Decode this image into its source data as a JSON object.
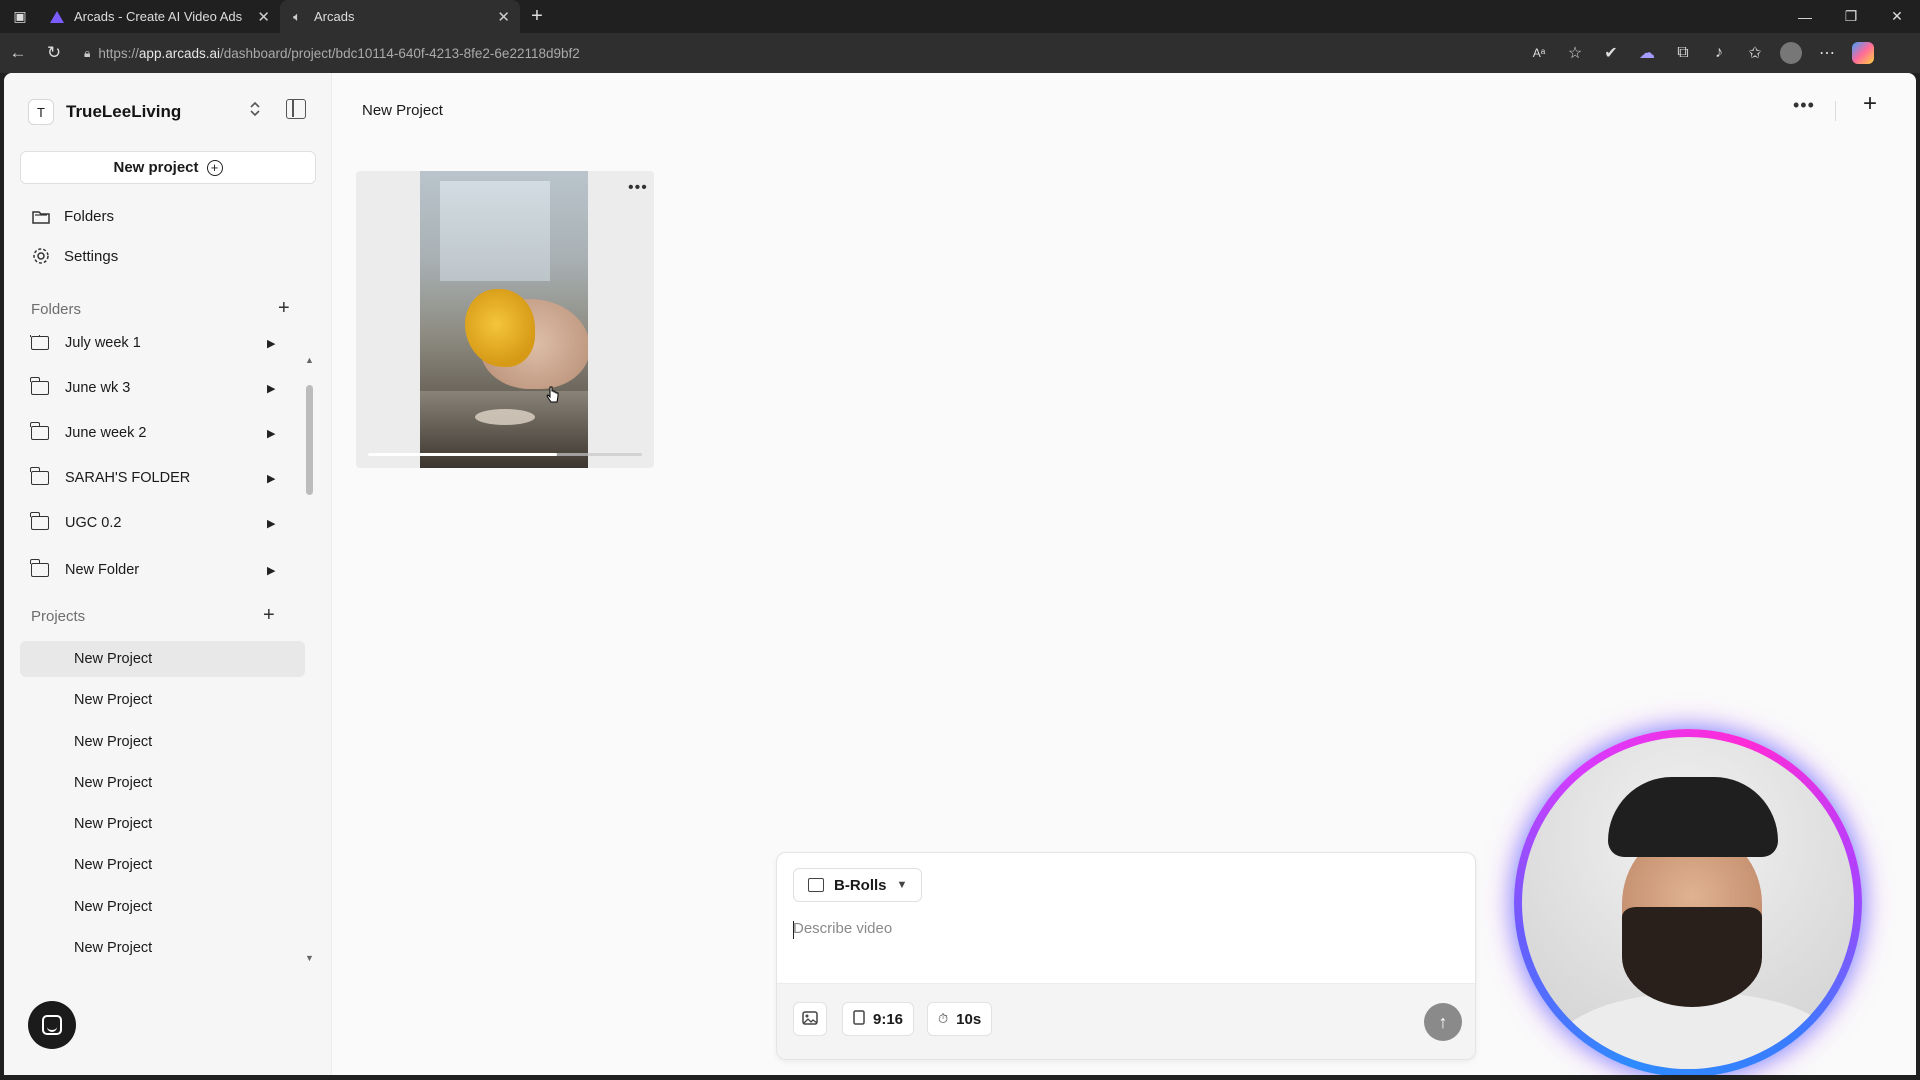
{
  "browser": {
    "tabs": [
      {
        "label": "Arcads - Create AI Video Ads",
        "icon": "arcads-logo-icon"
      },
      {
        "label": "Arcads",
        "icon": "speaker-icon"
      }
    ],
    "url_prefix": "https://",
    "url_domain": "app.arcads.ai",
    "url_path": "/dashboard/project/bdc10114-640f-4213-8fe2-6e22118d9bf2"
  },
  "sidebar": {
    "workspace_initial": "T",
    "workspace_name": "TrueLeeLiving",
    "new_project_label": "New project",
    "nav": [
      {
        "label": "Folders",
        "icon": "folder-icon"
      },
      {
        "label": "Settings",
        "icon": "gear-icon"
      }
    ],
    "folders_heading": "Folders",
    "folders": [
      {
        "name": "July week 1"
      },
      {
        "name": "June wk 3"
      },
      {
        "name": "June week 2"
      },
      {
        "name": "SARAH'S FOLDER"
      },
      {
        "name": "UGC 0.2"
      },
      {
        "name": "New Folder"
      }
    ],
    "projects_heading": "Projects",
    "projects": [
      {
        "name": "New Project",
        "active": true
      },
      {
        "name": "New Project"
      },
      {
        "name": "New Project"
      },
      {
        "name": "New Project"
      },
      {
        "name": "New Project"
      },
      {
        "name": "New Project"
      },
      {
        "name": "New Project"
      },
      {
        "name": "New Project"
      }
    ]
  },
  "main": {
    "title": "New Project",
    "video": {
      "progress": 0.69
    }
  },
  "prompt": {
    "mode_label": "B-Rolls",
    "placeholder": "Describe video",
    "aspect_ratio": "9:16",
    "duration": "10s"
  },
  "colors": {
    "browser_dark": "#202020",
    "app_bg": "#fafafa",
    "sidebar_bg": "#f6f6f6",
    "active_item_bg": "#e8e8e8",
    "send_button": "#8a8a8a"
  }
}
